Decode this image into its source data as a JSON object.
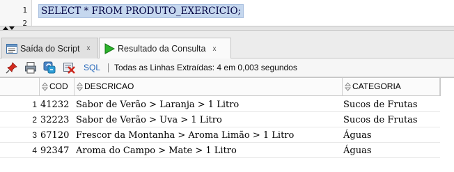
{
  "editor": {
    "lines": [
      "1",
      "2"
    ],
    "code": "SELECT * FROM PRODUTO_EXERCICIO;"
  },
  "tabs": [
    {
      "label": "Saída do Script",
      "close": "x",
      "icon": "script-output-icon",
      "active": false
    },
    {
      "label": "Resultado da Consulta",
      "close": "x",
      "icon": "run-query-icon",
      "active": true
    }
  ],
  "toolbar": {
    "icons": [
      "pin-icon",
      "print-icon",
      "refresh-icon",
      "clear-icon"
    ],
    "sql_label": "SQL",
    "status": "Todas as Linhas Extraídas: 4 em 0,003 segundos"
  },
  "grid": {
    "columns": [
      "COD",
      "DESCRICAO",
      "CATEGORIA"
    ],
    "rows": [
      {
        "num": "1",
        "cod": "41232",
        "descricao": "Sabor de Verão > Laranja > 1 Litro",
        "categoria": "Sucos de Frutas"
      },
      {
        "num": "2",
        "cod": "32223",
        "descricao": "Sabor de Verão > Uva > 1 Litro",
        "categoria": "Sucos de Frutas"
      },
      {
        "num": "3",
        "cod": "67120",
        "descricao": "Frescor da Montanha > Aroma Limão > 1 Litro",
        "categoria": "Águas"
      },
      {
        "num": "4",
        "cod": "92347",
        "descricao": "Aroma do Campo > Mate > 1 Litro",
        "categoria": "Águas"
      }
    ]
  },
  "colors": {
    "selection": "#c5d7ee",
    "run_green": "#1fa31f",
    "link_blue": "#1f63b8"
  }
}
